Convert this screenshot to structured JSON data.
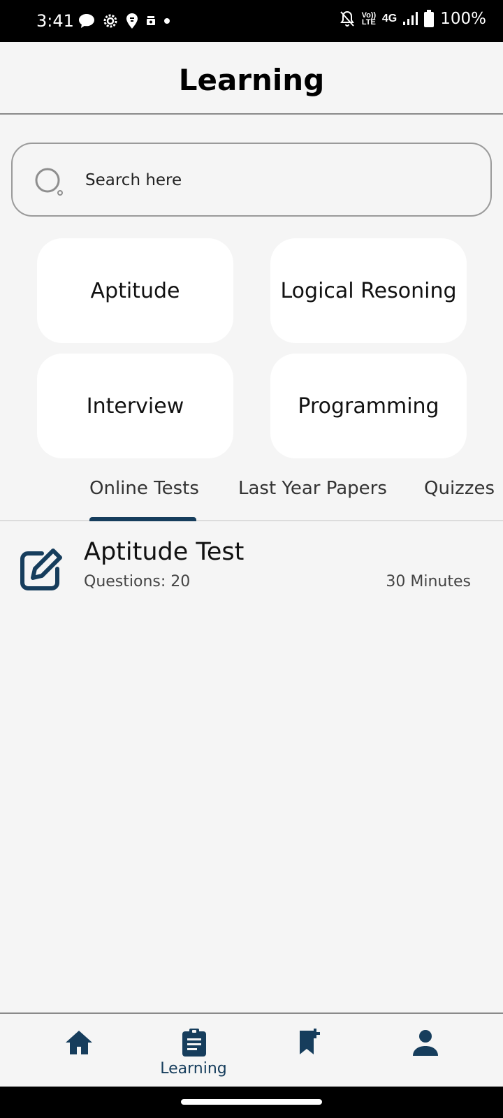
{
  "status_bar": {
    "time": "3:41",
    "network": "4G",
    "volte": "Vo)) LTE",
    "battery": "100%"
  },
  "header": {
    "title": "Learning"
  },
  "search": {
    "placeholder": "Search here",
    "value": ""
  },
  "categories": [
    {
      "label": "Aptitude"
    },
    {
      "label": "Logical Resoning"
    },
    {
      "label": "Interview"
    },
    {
      "label": "Programming"
    }
  ],
  "tabs": [
    {
      "label": "Online Tests",
      "active": true
    },
    {
      "label": "Last Year Papers",
      "active": false
    },
    {
      "label": "Quizzes",
      "active": false
    }
  ],
  "tests": [
    {
      "title": "Aptitude Test",
      "questions": "Questions: 20",
      "duration": "30 Minutes",
      "icon": "edit-icon"
    }
  ],
  "bottom_nav": {
    "items": [
      {
        "icon": "home-icon",
        "label": ""
      },
      {
        "icon": "clipboard-icon",
        "label": "Learning",
        "active": true
      },
      {
        "icon": "bookmark-add-icon",
        "label": ""
      },
      {
        "icon": "person-icon",
        "label": ""
      }
    ]
  },
  "colors": {
    "accent": "#163d5c",
    "background": "#f5f5f5",
    "card": "#ffffff"
  }
}
